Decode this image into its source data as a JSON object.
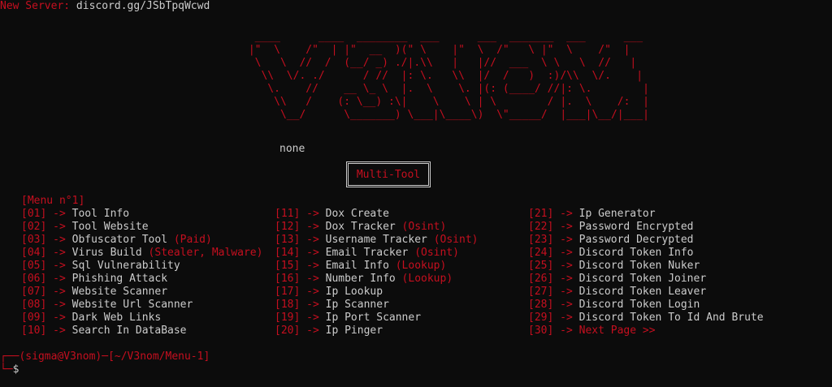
{
  "banner": {
    "label": "New Server:",
    "value": "discord.gg/JSbTpqWcwd"
  },
  "ascii_art": "  ____      ____  ________  ___      ___  _______  ___      ___\n |\"  \\    /\"  | |\"  __  )(\" \\    |\"  \\  /\"   \\ |\"  \\    /\"  |\n  \\   \\  //  /  (__/ _) ./|.\\\\   |   |//  ___  \\ \\   \\  //   |\n   \\\\  \\/. ./      / //  |: \\.   \\\\  |/  /   )  :)/\\\\  \\/.    |\n    \\.    //    __ \\_ \\  |.  \\    \\. |(: (____/ //|: \\.        |\n     \\\\   /    (: \\__) :\\|    \\    \\ | \\        / |.  \\    /:  |\n      \\__/      \\_______) \\___|\\____\\)  \\\"_____/  |___|\\__/|___|",
  "status_text": "none",
  "title_box": "Multi-Tool",
  "menu_header": {
    "open": "[",
    "label": "Menu n°1",
    "close": "]"
  },
  "arrow": " -> ",
  "columns": [
    [
      {
        "num": "01",
        "label": "Tool Info",
        "tag": ""
      },
      {
        "num": "02",
        "label": "Tool Website",
        "tag": ""
      },
      {
        "num": "03",
        "label": "Obfuscator Tool ",
        "tag": "(Paid)"
      },
      {
        "num": "04",
        "label": "Virus Build ",
        "tag": "(Stealer, Malware)"
      },
      {
        "num": "05",
        "label": "Sql Vulnerability",
        "tag": ""
      },
      {
        "num": "06",
        "label": "Phishing Attack",
        "tag": ""
      },
      {
        "num": "07",
        "label": "Website Scanner",
        "tag": ""
      },
      {
        "num": "08",
        "label": "Website Url Scanner",
        "tag": ""
      },
      {
        "num": "09",
        "label": "Dark Web Links",
        "tag": ""
      },
      {
        "num": "10",
        "label": "Search In DataBase",
        "tag": ""
      }
    ],
    [
      {
        "num": "11",
        "label": "Dox Create",
        "tag": ""
      },
      {
        "num": "12",
        "label": "Dox Tracker ",
        "tag": "(Osint)"
      },
      {
        "num": "13",
        "label": "Username Tracker ",
        "tag": "(Osint)"
      },
      {
        "num": "14",
        "label": "Email Tracker ",
        "tag": "(Osint)"
      },
      {
        "num": "15",
        "label": "Email Info ",
        "tag": "(Lookup)"
      },
      {
        "num": "16",
        "label": "Number Info ",
        "tag": "(Lookup)"
      },
      {
        "num": "17",
        "label": "Ip Lookup",
        "tag": ""
      },
      {
        "num": "18",
        "label": "Ip Scanner",
        "tag": ""
      },
      {
        "num": "19",
        "label": "Ip Port Scanner",
        "tag": ""
      },
      {
        "num": "20",
        "label": "Ip Pinger",
        "tag": ""
      }
    ],
    [
      {
        "num": "21",
        "label": "Ip Generator",
        "tag": ""
      },
      {
        "num": "22",
        "label": "Password Encrypted",
        "tag": ""
      },
      {
        "num": "23",
        "label": "Password Decrypted",
        "tag": ""
      },
      {
        "num": "24",
        "label": "Discord Token Info",
        "tag": ""
      },
      {
        "num": "25",
        "label": "Discord Token Nuker",
        "tag": ""
      },
      {
        "num": "26",
        "label": "Discord Token Joiner",
        "tag": ""
      },
      {
        "num": "27",
        "label": "Discord Token Leaver",
        "tag": ""
      },
      {
        "num": "28",
        "label": "Discord Token Login",
        "tag": ""
      },
      {
        "num": "29",
        "label": "Discord Token To Id And Brute",
        "tag": ""
      },
      {
        "num": "30",
        "label": "",
        "tag": "Next Page >>"
      }
    ]
  ],
  "prompt": {
    "corner_top": "┌──",
    "user": "(sigma@V3nom)",
    "sep": "─",
    "path": "[~/V3nom/Menu-1]",
    "corner_bottom": "└─",
    "symbol": "$"
  },
  "colors": {
    "accent": "#c50f1f",
    "text": "#cccccc",
    "background": "#0c0c0c"
  }
}
